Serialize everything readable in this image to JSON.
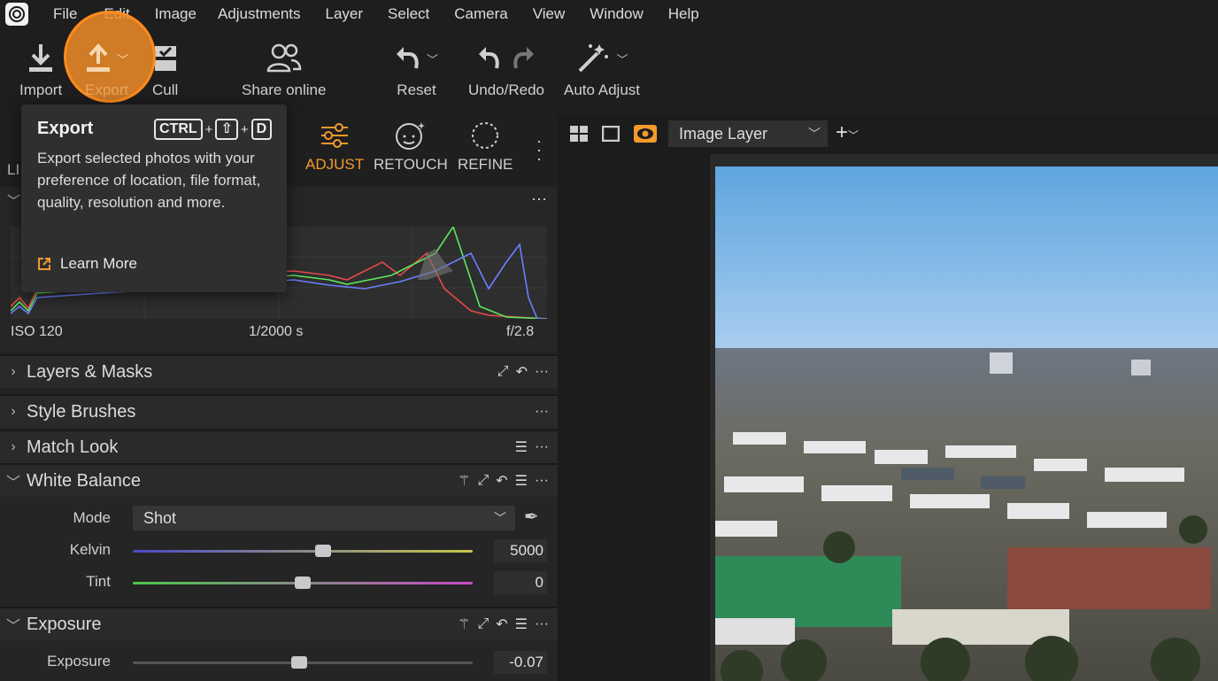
{
  "menu": {
    "items": [
      "File",
      "Edit",
      "Image",
      "Adjustments",
      "Layer",
      "Select",
      "Camera",
      "View",
      "Window",
      "Help"
    ]
  },
  "toolbar": {
    "import": "Import",
    "export": "Export",
    "cull": "Cull",
    "share": "Share online",
    "reset": "Reset",
    "undo_redo": "Undo/Redo",
    "auto_adjust": "Auto Adjust"
  },
  "tooltip": {
    "title": "Export",
    "keys": [
      "CTRL",
      "⇧",
      "D"
    ],
    "description": "Export selected photos with your preference of location, file format, quality, resolution and more.",
    "link": "Learn More"
  },
  "tabs": {
    "partial_left": "LI",
    "adjust": "ADJUST",
    "retouch": "RETOUCH",
    "refine": "REFINE"
  },
  "exif": {
    "iso": "ISO 120",
    "shutter": "1/2000 s",
    "aperture": "f/2.8"
  },
  "sections": {
    "layers_masks": "Layers & Masks",
    "style_brushes": "Style Brushes",
    "match_look": "Match Look",
    "white_balance": "White Balance",
    "exposure": "Exposure"
  },
  "white_balance": {
    "mode_label": "Mode",
    "mode_value": "Shot",
    "kelvin_label": "Kelvin",
    "kelvin_value": "5000",
    "tint_label": "Tint",
    "tint_value": "0"
  },
  "exposure": {
    "label": "Exposure",
    "value": "-0.07"
  },
  "viewer": {
    "layer_select": "Image Layer"
  },
  "colors": {
    "accent": "#f39a2c",
    "highlight": "#ff8a1e"
  }
}
